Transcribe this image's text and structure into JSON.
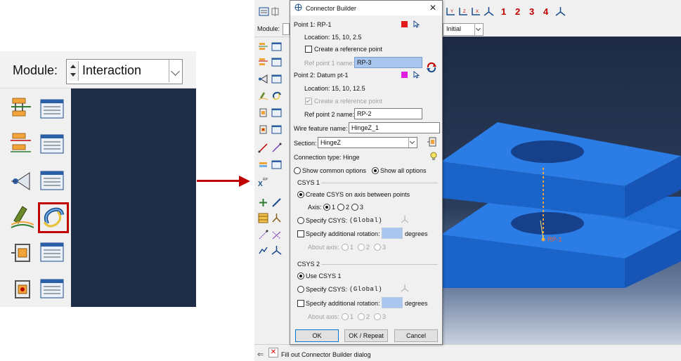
{
  "left_zoom": {
    "module_label": "Module:",
    "module_value": "Interaction"
  },
  "app": {
    "context_bar": {
      "module_label": "Module:",
      "step_value": "Initial"
    },
    "toolbar_numbers": [
      "1",
      "2",
      "3",
      "4"
    ],
    "status_text": "Fill out Connector Builder dialog",
    "viewport_label": "RP-1"
  },
  "dialog": {
    "title": "Connector Builder",
    "point1": {
      "header": "Point 1:  RP-1",
      "location": "Location:  15, 10, 2.5",
      "create_ref": "Create a reference point",
      "ref_name_label": "Ref point 1 name:",
      "ref_name_value": "RP-3",
      "color": "#e31b1b"
    },
    "point2": {
      "header": "Point 2:  Datum pt-1",
      "location": "Location:  15, 10, 12.5",
      "create_ref": "Create a reference point",
      "ref_name_label": "Ref point 2 name:",
      "ref_name_value": "RP-2",
      "color": "#e01ee0"
    },
    "wire_label": "Wire feature name:",
    "wire_value": "HingeZ_1",
    "section_label": "Section:",
    "section_value": "HingeZ",
    "connection_type": "Connection type:  Hinge",
    "show_common": "Show common options",
    "show_all": "Show all options",
    "csys1": {
      "title": "CSYS 1",
      "create_csys": "Create CSYS on axis between points",
      "axis_label": "Axis:",
      "axis_options": [
        "1",
        "2",
        "3"
      ],
      "specify_csys": "Specify CSYS:",
      "csys_value": "(Global)",
      "additional_rotation": "Specify additional rotation:",
      "degrees": "degrees",
      "about_axis": "About axis:",
      "about_options": [
        "1",
        "2",
        "3"
      ]
    },
    "csys2": {
      "title": "CSYS 2",
      "use_csys1": "Use CSYS 1",
      "specify_csys": "Specify CSYS:",
      "csys_value": "(Global)",
      "additional_rotation": "Specify additional rotation:",
      "degrees": "degrees",
      "about_axis": "About axis:",
      "about_options": [
        "1",
        "2",
        "3"
      ]
    },
    "buttons": {
      "ok": "OK",
      "ok_repeat": "OK / Repeat",
      "cancel": "Cancel"
    }
  },
  "colors": {
    "highlight": "#c00000",
    "part_blue": "#1f6fd6",
    "viewport_dark": "#1f2d46"
  }
}
